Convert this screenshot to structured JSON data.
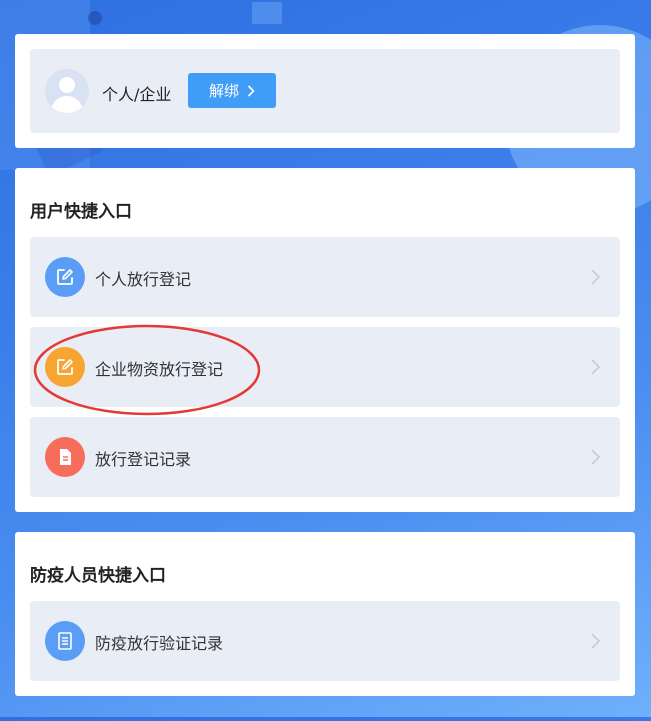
{
  "profile": {
    "name": "个人/企业",
    "unbind_label": "解绑"
  },
  "user_section": {
    "title": "用户快捷入口",
    "items": [
      {
        "label": "个人放行登记",
        "icon": "edit-icon",
        "color": "#5a9df6"
      },
      {
        "label": "企业物资放行登记",
        "icon": "edit-icon",
        "color": "#f7a531"
      },
      {
        "label": "放行登记记录",
        "icon": "document-icon",
        "color": "#f76d5c"
      }
    ]
  },
  "epidemic_section": {
    "title": "防疫人员快捷入口",
    "items": [
      {
        "label": "防疫放行验证记录",
        "icon": "list-document-icon",
        "color": "#5a9df6"
      }
    ]
  },
  "colors": {
    "accent": "#3f9cf7",
    "highlight": "#e53935",
    "entry_bg": "#e9eef6"
  }
}
